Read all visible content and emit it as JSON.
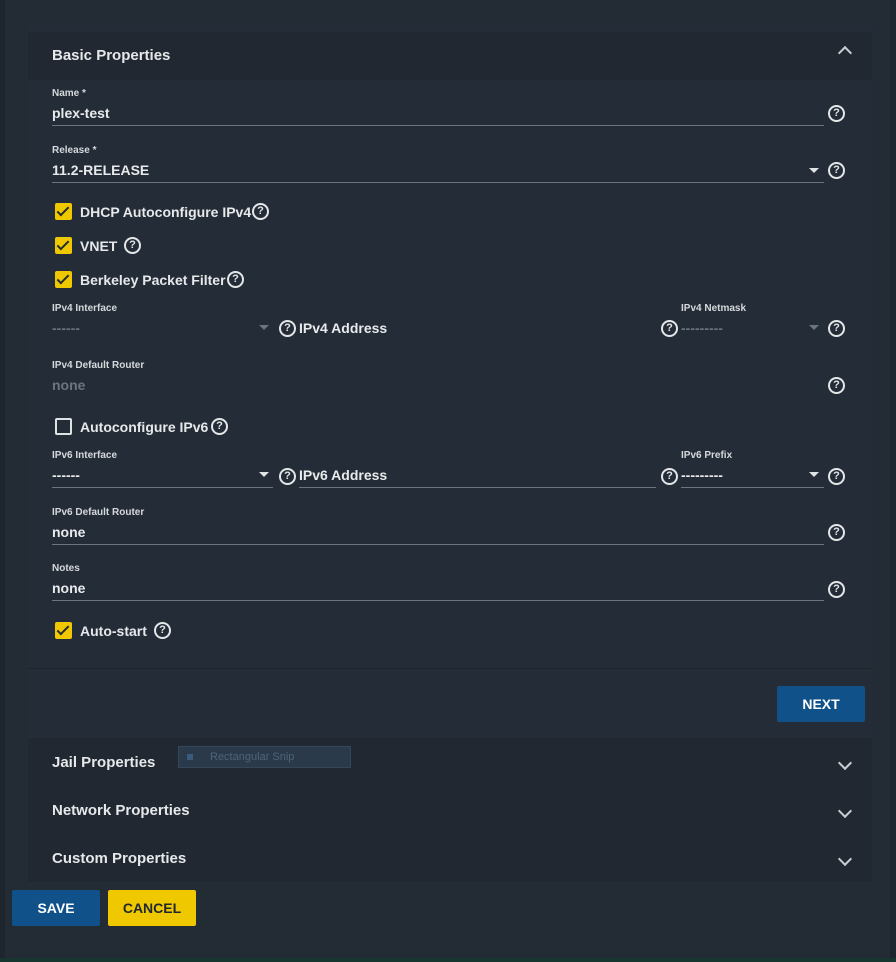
{
  "sections": {
    "basic": {
      "title": "Basic Properties"
    },
    "jail": {
      "title": "Jail Properties"
    },
    "network": {
      "title": "Network Properties"
    },
    "custom": {
      "title": "Custom Properties"
    }
  },
  "fields": {
    "name": {
      "label": "Name *",
      "value": "plex-test"
    },
    "release": {
      "label": "Release *",
      "value": "11.2-RELEASE"
    },
    "ipv4_interface": {
      "label": "IPv4 Interface",
      "value": "------"
    },
    "ipv4_address": {
      "placeholder": "IPv4 Address"
    },
    "ipv4_netmask": {
      "label": "IPv4 Netmask",
      "value": "---------"
    },
    "ipv4_router": {
      "label": "IPv4 Default Router",
      "value": "none"
    },
    "ipv6_interface": {
      "label": "IPv6 Interface",
      "value": "------"
    },
    "ipv6_address": {
      "placeholder": "IPv6 Address"
    },
    "ipv6_prefix": {
      "label": "IPv6 Prefix",
      "value": "---------"
    },
    "ipv6_router": {
      "label": "IPv6 Default Router",
      "value": "none"
    },
    "notes": {
      "label": "Notes",
      "value": "none"
    }
  },
  "checkboxes": {
    "dhcp": {
      "label": "DHCP Autoconfigure IPv4",
      "checked": true
    },
    "vnet": {
      "label": "VNET",
      "checked": true
    },
    "bpf": {
      "label": "Berkeley Packet Filter",
      "checked": true
    },
    "ipv6_auto": {
      "label": "Autoconfigure IPv6",
      "checked": false
    },
    "autostart": {
      "label": "Auto-start",
      "checked": true
    }
  },
  "help_glyph": "?",
  "buttons": {
    "next": "NEXT",
    "save": "SAVE",
    "cancel": "CANCEL"
  },
  "overlay": {
    "snip_label": "Rectangular Snip"
  },
  "colors": {
    "background": "#232b34",
    "accent_yellow": "#f0c800",
    "primary_blue": "#0f5188"
  }
}
